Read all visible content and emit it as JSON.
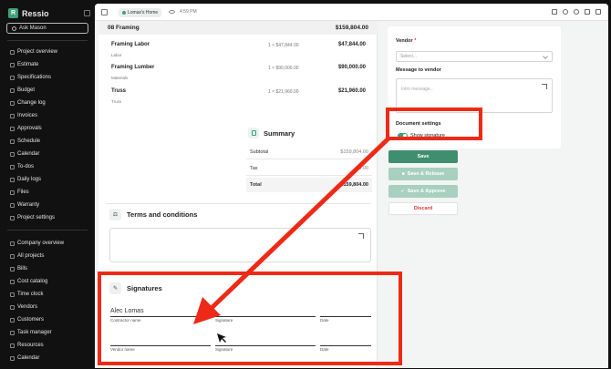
{
  "app": {
    "name": "Ressio",
    "ask_label": "Ask Mason"
  },
  "sidebar": {
    "project_items": [
      "Project overview",
      "Estimate",
      "Specifications",
      "Budget",
      "Change log",
      "Invoices",
      "Approvals",
      "Schedule",
      "Calendar",
      "To-dos",
      "Daily logs",
      "Files",
      "Warranty",
      "Project settings"
    ],
    "company_items": [
      "Company overview",
      "All projects",
      "Bills",
      "Cost catalog",
      "Time clock",
      "Vendors",
      "Customers",
      "Task manager",
      "Resources",
      "Calendar"
    ]
  },
  "topbar": {
    "breadcrumb": "Lomax's Home",
    "time": "4:59 PM"
  },
  "doc": {
    "section": {
      "title": "08 Framing",
      "total": "$159,804.00"
    },
    "line_items": [
      {
        "name": "Framing Labor",
        "category": "Labor",
        "qty": "1 × $47,844.00",
        "amount": "$47,844.00"
      },
      {
        "name": "Framing Lumber",
        "category": "Materials",
        "qty": "1 × $90,000.00",
        "amount": "$90,000.00"
      },
      {
        "name": "Truss",
        "category": "Truss",
        "qty": "1 × $21,960.00",
        "amount": "$21,960.00"
      }
    ],
    "summary": {
      "title": "Summary",
      "rows": [
        {
          "label": "Subtotal",
          "value": "$159,804.00"
        },
        {
          "label": "Tax",
          "value": "$0.00"
        },
        {
          "label": "Total",
          "value": "$159,804.00"
        }
      ]
    },
    "terms": {
      "title": "Terms and conditions"
    },
    "signatures": {
      "title": "Signatures",
      "contractor_name_value": "Alec Lomas",
      "contractor_name_label": "Contractor name",
      "signature_label": "Signature",
      "date_label": "Date",
      "vendor_name_label": "Vendor name"
    }
  },
  "panel": {
    "vendor_label": "Vendor",
    "vendor_required": "*",
    "vendor_placeholder": "Select...",
    "message_label": "Message to vendor",
    "message_placeholder": "Intro message...",
    "doc_settings_label": "Document settings",
    "show_signature_label": "Show signature",
    "show_signature_on": true,
    "buttons": {
      "save": "Save",
      "save_release": "Save & Release",
      "save_approve": "Save & Approve",
      "discard": "Discard"
    }
  },
  "colors": {
    "accent": "#3f9f7a",
    "annotation": "#ee2a16",
    "danger": "#dd3333"
  }
}
